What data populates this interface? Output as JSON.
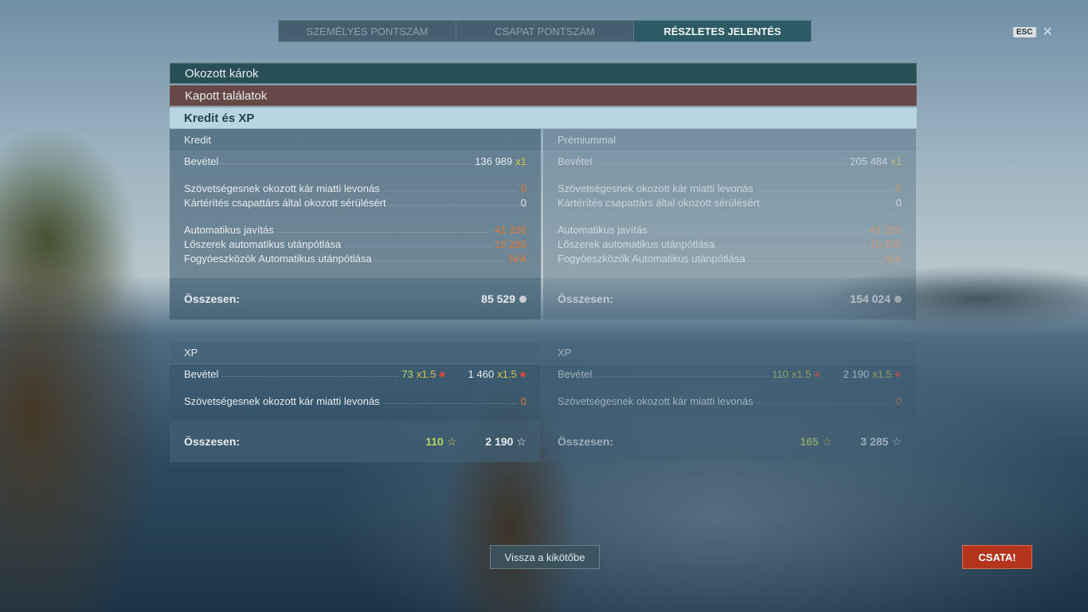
{
  "tabs": [
    {
      "label": "SZEMÉLYES PONTSZÁM"
    },
    {
      "label": "CSAPAT PONTSZÁM"
    },
    {
      "label": "RÉSZLETES JELENTÉS"
    }
  ],
  "esc": {
    "key": "ESC",
    "close": "✕"
  },
  "sections": {
    "damage": "Okozott károk",
    "received": "Kapott találatok",
    "credits_xp": "Kredit és XP"
  },
  "credits": {
    "header": "Kredit",
    "income_label": "Bevétel",
    "income_value": "136 989",
    "income_mult": "x1",
    "ally_damage_label": "Szövetségesnek okozott kár miatti levonás",
    "ally_damage_value": "0",
    "compensation_label": "Kártérítés csapattárs által okozott sérülésért",
    "compensation_value": "0",
    "repair_label": "Automatikus javítás",
    "repair_value": "41 200",
    "ammo_label": "Lőszerek automatikus utánpótlása",
    "ammo_value": "10 260",
    "consumables_label": "Fogyóeszközök Automatikus utánpótlása",
    "consumables_value": "N/A",
    "total_label": "Összesen:",
    "total_value": "85 529"
  },
  "premium_credits": {
    "header": "Prémiummal",
    "income_label": "Bevétel",
    "income_value": "205 484",
    "income_mult": "x1",
    "ally_damage_label": "Szövetségesnek okozott kár miatti levonás",
    "ally_damage_value": "0",
    "compensation_label": "Kártérítés csapattárs által okozott sérülésért",
    "compensation_value": "0",
    "repair_label": "Automatikus javítás",
    "repair_value": "41 200",
    "ammo_label": "Lőszerek automatikus utánpótlása",
    "ammo_value": "10 260",
    "consumables_label": "Fogyóeszközök Automatikus utánpótlása",
    "consumables_value": "N/A",
    "total_label": "Összesen:",
    "total_value": "154 024"
  },
  "xp": {
    "header": "XP",
    "income_label": "Bevétel",
    "income_xp": "73",
    "income_xp_mult": "x1.5",
    "income_free": "1 460",
    "income_free_mult": "x1.5",
    "ally_damage_label": "Szövetségesnek okozott kár miatti levonás",
    "ally_damage_value": "0",
    "total_label": "Összesen:",
    "total_xp": "110",
    "total_free": "2 190"
  },
  "premium_xp": {
    "header": "XP",
    "income_label": "Bevétel",
    "income_xp": "110",
    "income_xp_mult": "x1.5",
    "income_free": "2 190",
    "income_free_mult": "x1.5",
    "ally_damage_label": "Szövetségesnek okozott kár miatti levonás",
    "ally_damage_value": "0",
    "total_label": "Összesen:",
    "total_xp": "165",
    "total_free": "3 285"
  },
  "buttons": {
    "back": "Vissza a kikötőbe",
    "battle": "CSATA!"
  },
  "icons": {
    "credit": "credit-coin-icon",
    "xp": "star-icon",
    "flag": "flag-badge-icon"
  }
}
